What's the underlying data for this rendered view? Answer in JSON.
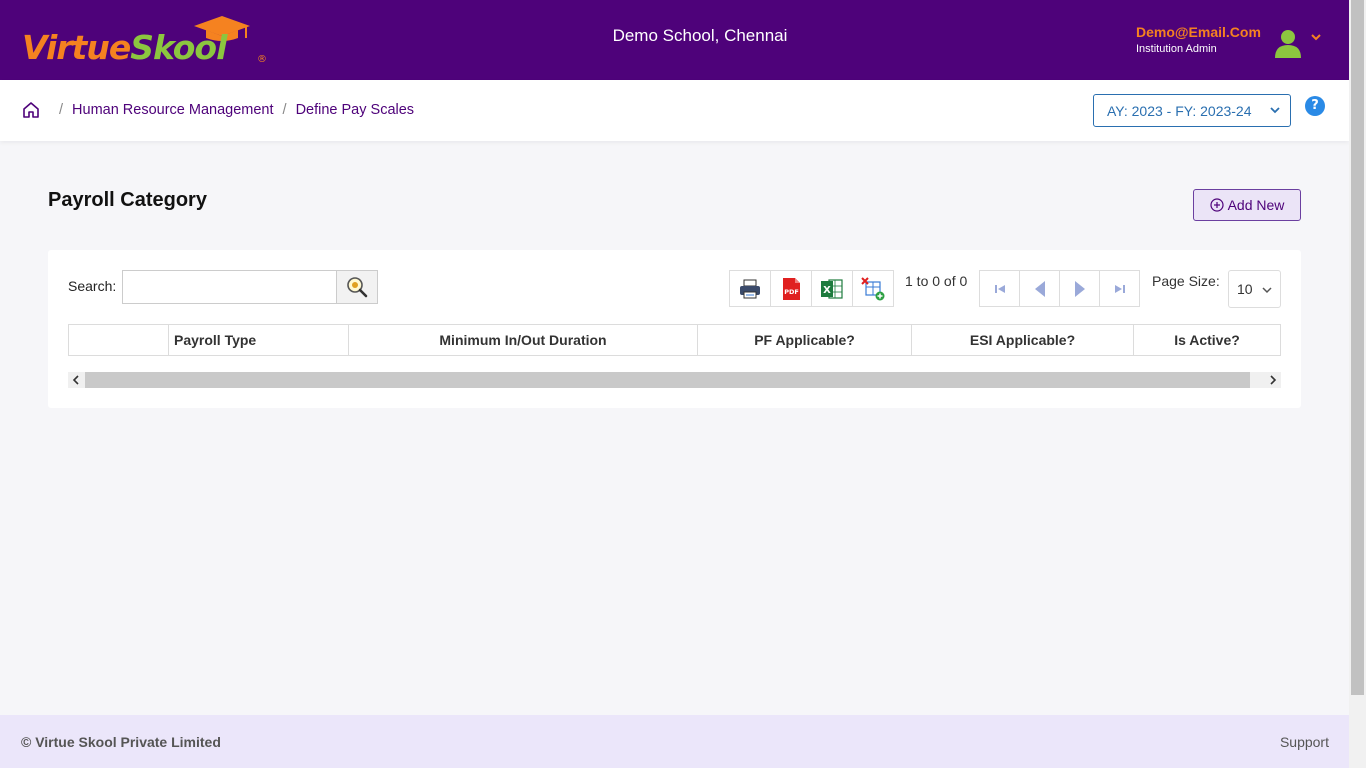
{
  "brand": {
    "name_part1": "Virtue",
    "name_part2": "Skool",
    "registered": "®"
  },
  "header": {
    "school_name": "Demo School, Chennai",
    "user_email": "Demo@Email.Com",
    "user_role": "Institution Admin"
  },
  "breadcrumb": {
    "items": [
      "Human Resource Management",
      "Define Pay Scales"
    ],
    "separator": "/"
  },
  "academic_year": {
    "selected": "AY: 2023 - FY: 2023-24"
  },
  "help": {
    "label": "?"
  },
  "page": {
    "title": "Payroll Category",
    "add_button": "Add New"
  },
  "grid": {
    "search_label": "Search:",
    "search_value": "",
    "pager_info": "1 to 0 of 0",
    "page_size_label": "Page Size:",
    "page_size": "10",
    "columns": [
      "",
      "Payroll Type",
      "Minimum In/Out Duration",
      "PF Applicable?",
      "ESI Applicable?",
      "Is Active?"
    ]
  },
  "footer": {
    "copyright": "© Virtue Skool Private Limited",
    "support": "Support"
  },
  "colors": {
    "header_bg": "#4e027a",
    "brand_orange": "#f58220",
    "brand_green": "#8cc63f",
    "footer_bg": "#ebe6fa"
  }
}
